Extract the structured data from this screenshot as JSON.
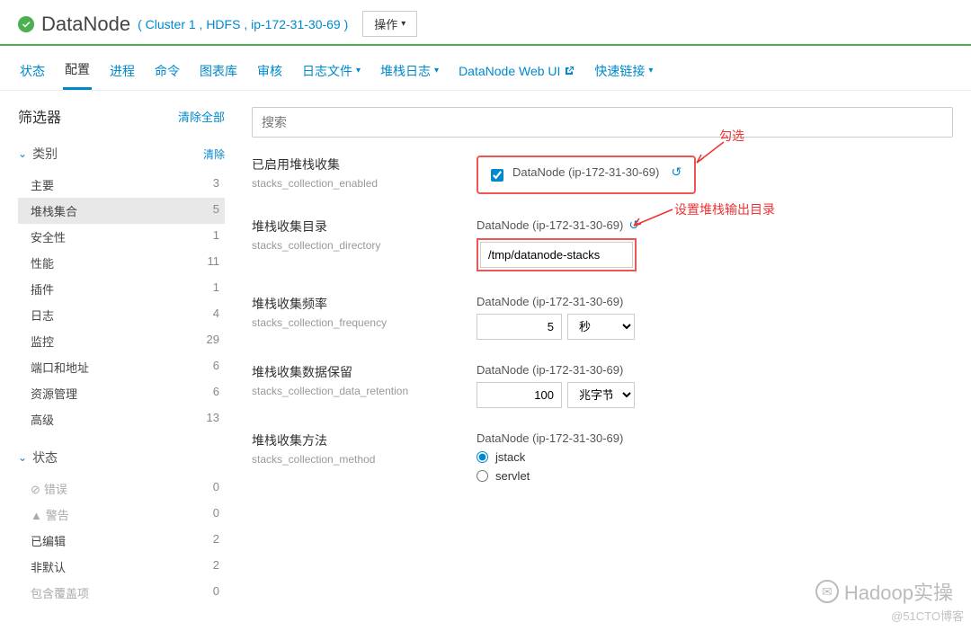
{
  "header": {
    "title": "DataNode",
    "breadcrumb": "( Cluster 1 , HDFS , ip-172-31-30-69 )",
    "actions_label": "操作"
  },
  "tabs": {
    "items": [
      {
        "label": "状态"
      },
      {
        "label": "配置"
      },
      {
        "label": "进程"
      },
      {
        "label": "命令"
      },
      {
        "label": "图表库"
      },
      {
        "label": "审核"
      },
      {
        "label": "日志文件",
        "dropdown": true
      },
      {
        "label": "堆栈日志",
        "dropdown": true
      },
      {
        "label": "DataNode Web UI",
        "external": true
      },
      {
        "label": "快速链接",
        "dropdown": true
      }
    ]
  },
  "sidebar": {
    "title": "筛选器",
    "clear_all": "清除全部",
    "groups": [
      {
        "name": "类别",
        "clear": "清除",
        "items": [
          {
            "label": "主要",
            "count": "3"
          },
          {
            "label": "堆栈集合",
            "count": "5",
            "selected": true
          },
          {
            "label": "安全性",
            "count": "1"
          },
          {
            "label": "性能",
            "count": "11"
          },
          {
            "label": "插件",
            "count": "1"
          },
          {
            "label": "日志",
            "count": "4"
          },
          {
            "label": "监控",
            "count": "29"
          },
          {
            "label": "端口和地址",
            "count": "6"
          },
          {
            "label": "资源管理",
            "count": "6"
          },
          {
            "label": "高级",
            "count": "13"
          }
        ]
      },
      {
        "name": "状态",
        "items": [
          {
            "label": "错误",
            "count": "0",
            "disabled": true,
            "icon": "error"
          },
          {
            "label": "警告",
            "count": "0",
            "disabled": true,
            "icon": "warning"
          },
          {
            "label": "已编辑",
            "count": "2"
          },
          {
            "label": "非默认",
            "count": "2"
          },
          {
            "label": "包含覆盖项",
            "count": "0",
            "disabled": true
          }
        ]
      }
    ]
  },
  "search": {
    "placeholder": "搜索"
  },
  "configs": [
    {
      "name": "已启用堆栈收集",
      "key": "stacks_collection_enabled",
      "type": "checkbox",
      "node": "DataNode (ip-172-31-30-69)",
      "revert": true,
      "checked": true
    },
    {
      "name": "堆栈收集目录",
      "key": "stacks_collection_directory",
      "type": "text",
      "node": "DataNode (ip-172-31-30-69)",
      "revert": true,
      "value": "/tmp/datanode-stacks"
    },
    {
      "name": "堆栈收集频率",
      "key": "stacks_collection_frequency",
      "type": "number",
      "node": "DataNode (ip-172-31-30-69)",
      "value": "5",
      "unit": "秒"
    },
    {
      "name": "堆栈收集数据保留",
      "key": "stacks_collection_data_retention",
      "type": "number",
      "node": "DataNode (ip-172-31-30-69)",
      "value": "100",
      "unit": "兆字节"
    },
    {
      "name": "堆栈收集方法",
      "key": "stacks_collection_method",
      "type": "radio",
      "node": "DataNode (ip-172-31-30-69)",
      "options": [
        "jstack",
        "servlet"
      ],
      "selected": "jstack"
    }
  ],
  "annotations": {
    "check": "勾选",
    "dir": "设置堆栈输出目录"
  },
  "watermark": {
    "main": "Hadoop实操",
    "sub": "@51CTO博客"
  }
}
